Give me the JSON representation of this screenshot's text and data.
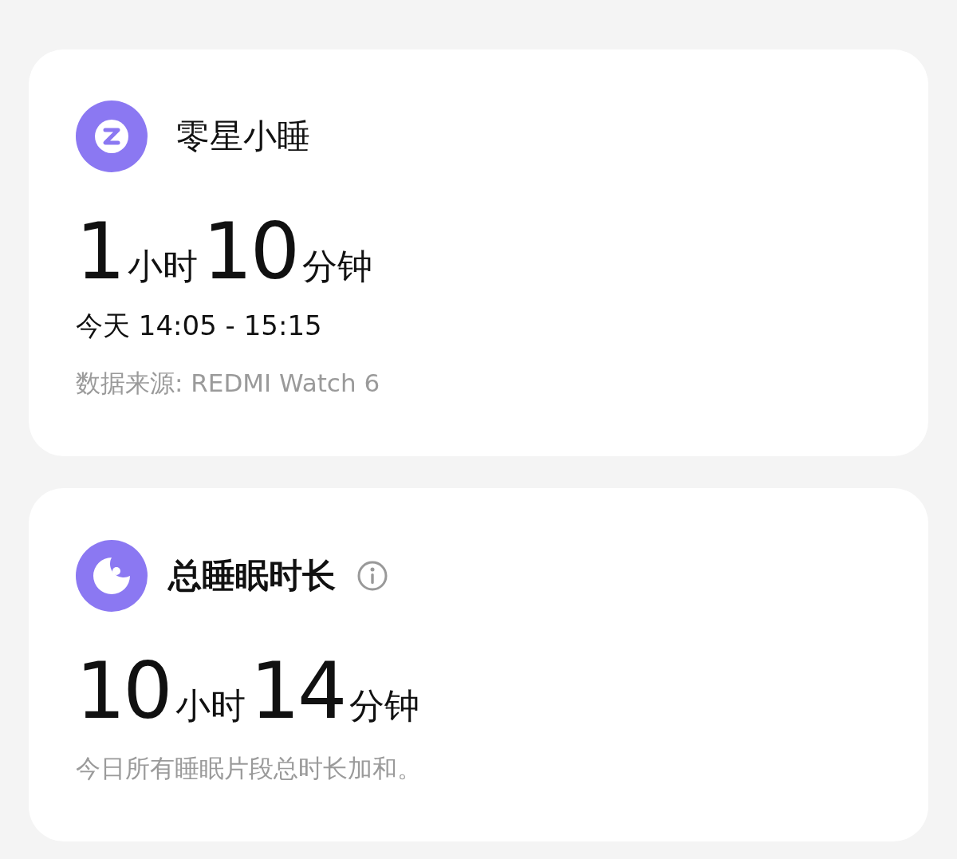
{
  "cards": [
    {
      "kind": "nap",
      "title": "零星小睡",
      "info": false,
      "value": [
        {
          "kind": "number",
          "text": "1"
        },
        {
          "kind": "unit",
          "text": "小时"
        },
        {
          "kind": "number",
          "text": "10"
        },
        {
          "kind": "unit",
          "text": "分钟"
        }
      ],
      "lines": [
        {
          "kind": "time",
          "text": "今天 14:05 - 15:15"
        },
        {
          "kind": "note",
          "text": "数据来源: REDMI Watch 6"
        }
      ]
    },
    {
      "kind": "moon",
      "title": "总睡眠时长",
      "info": true,
      "value": [
        {
          "kind": "number",
          "text": "10"
        },
        {
          "kind": "unit",
          "text": "小时"
        },
        {
          "kind": "number",
          "text": "14"
        },
        {
          "kind": "unit",
          "text": "分钟"
        }
      ],
      "lines": [
        {
          "kind": "note",
          "text": "今日所有睡眠片段总时长加和。"
        }
      ]
    }
  ]
}
